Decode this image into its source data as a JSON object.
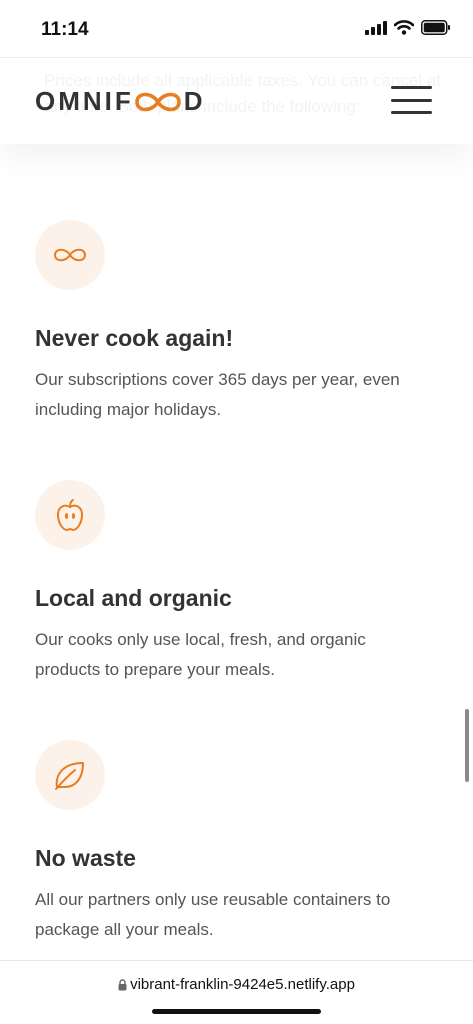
{
  "status_bar": {
    "time": "11:14"
  },
  "header": {
    "logo_prefix": "OMNIF",
    "logo_suffix": "D",
    "background_text": "Prices include all applicable taxes. You can cancel at any time. Both plans include the following:"
  },
  "features": [
    {
      "icon": "infinity-icon",
      "title": "Never cook again!",
      "text": "Our subscriptions cover 365 days per year, even including major holidays."
    },
    {
      "icon": "apple-icon",
      "title": "Local and organic",
      "text": "Our cooks only use local, fresh, and organic products to prepare your meals."
    },
    {
      "icon": "leaf-icon",
      "title": "No waste",
      "text": "All our partners only use reusable containers to package all your meals."
    }
  ],
  "browser": {
    "url": "vibrant-franklin-9424e5.netlify.app"
  },
  "colors": {
    "accent": "#e67e22",
    "icon_bg": "#fdf2e9",
    "text_dark": "#333333"
  }
}
